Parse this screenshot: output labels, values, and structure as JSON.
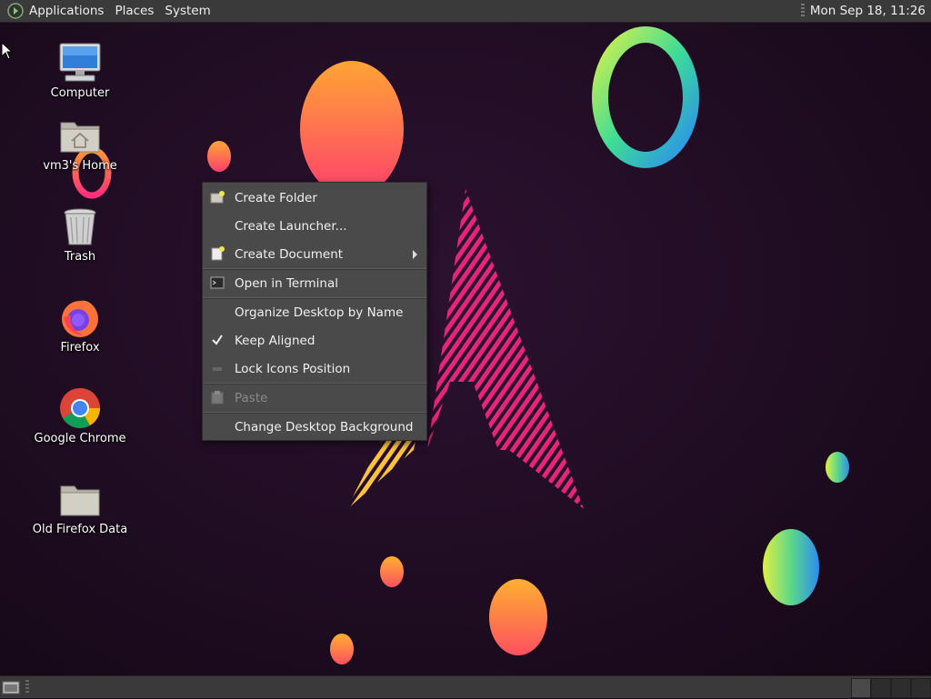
{
  "top_panel": {
    "menus": [
      "Applications",
      "Places",
      "System"
    ],
    "clock": "Mon Sep 18, 11:26",
    "logo_icon": "distro-logo-icon"
  },
  "desktop_icons": [
    {
      "label": "Computer",
      "icon": "computer-icon"
    },
    {
      "label": "vm3's Home",
      "icon": "home-folder-icon"
    },
    {
      "label": "Trash",
      "icon": "trash-icon"
    },
    {
      "label": "Firefox",
      "icon": "firefox-icon"
    },
    {
      "label": "Google Chrome",
      "icon": "chrome-icon"
    },
    {
      "label": "Old Firefox Data",
      "icon": "folder-icon"
    }
  ],
  "context_menu": {
    "items": [
      {
        "label": "Create Folder",
        "icon": "new-folder-icon",
        "enabled": true
      },
      {
        "label": "Create Launcher...",
        "icon": "",
        "enabled": true
      },
      {
        "label": "Create Document",
        "icon": "new-document-icon",
        "enabled": true,
        "submenu": true
      },
      {
        "label": "Open in Terminal",
        "icon": "terminal-icon",
        "enabled": true
      },
      {
        "label": "Organize Desktop by Name",
        "icon": "",
        "enabled": true
      },
      {
        "label": "Keep Aligned",
        "icon": "checkmark-icon",
        "enabled": true,
        "checked": true
      },
      {
        "label": "Lock Icons Position",
        "icon": "lock-toggle-icon",
        "enabled": true
      },
      {
        "label": "Paste",
        "icon": "paste-icon",
        "enabled": false
      },
      {
        "label": "Change Desktop Background",
        "icon": "",
        "enabled": true
      }
    ]
  },
  "bottom_panel": {
    "show_desktop_icon": "show-desktop-icon",
    "workspaces": 4,
    "active_workspace": 1
  },
  "colors": {
    "panel_bg": "#3a3a3a",
    "menu_bg": "#4a4a4a",
    "wallpaper_bg": "#1f0c22",
    "accent_pink": "#e8237a",
    "accent_orange": "#ff9a3c"
  }
}
